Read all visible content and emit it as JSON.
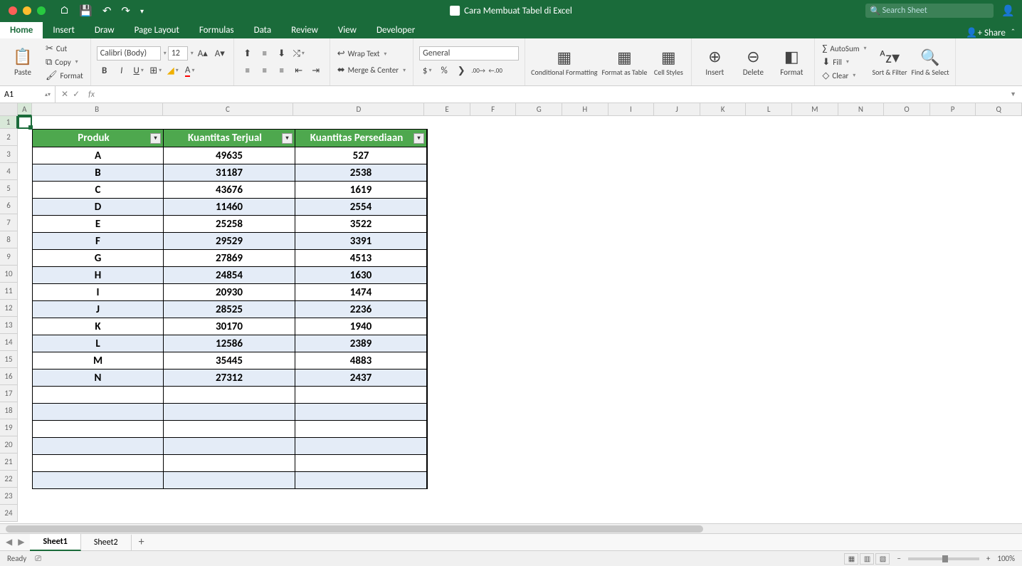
{
  "window": {
    "title": "Cara Membuat Tabel di Excel",
    "search_placeholder": "Search Sheet"
  },
  "tabs": [
    "Home",
    "Insert",
    "Draw",
    "Page Layout",
    "Formulas",
    "Data",
    "Review",
    "View",
    "Developer"
  ],
  "share_label": "Share",
  "ribbon": {
    "paste": "Paste",
    "cut": "Cut",
    "copy": "Copy",
    "format_painter": "Format",
    "font_name": "Calibri (Body)",
    "font_size": "12",
    "wrap_text": "Wrap Text",
    "merge_center": "Merge & Center",
    "number_format": "General",
    "cond_fmt": "Conditional Formatting",
    "fmt_table": "Format as Table",
    "cell_styles": "Cell Styles",
    "insert": "Insert",
    "delete": "Delete",
    "format": "Format",
    "autosum": "AutoSum",
    "fill": "Fill",
    "clear": "Clear",
    "sort_filter": "Sort & Filter",
    "find_select": "Find & Select"
  },
  "cell_ref": "A1",
  "columns": [
    "A",
    "B",
    "C",
    "D",
    "E",
    "F",
    "G",
    "H",
    "I",
    "J",
    "K",
    "L",
    "M",
    "N",
    "O",
    "P",
    "Q"
  ],
  "table": {
    "headers": [
      "Produk",
      "Kuantitas Terjual",
      "Kuantitas Persediaan"
    ],
    "rows": [
      [
        "A",
        "49635",
        "527"
      ],
      [
        "B",
        "31187",
        "2538"
      ],
      [
        "C",
        "43676",
        "1619"
      ],
      [
        "D",
        "11460",
        "2554"
      ],
      [
        "E",
        "25258",
        "3522"
      ],
      [
        "F",
        "29529",
        "3391"
      ],
      [
        "G",
        "27869",
        "4513"
      ],
      [
        "H",
        "24854",
        "1630"
      ],
      [
        "I",
        "20930",
        "1474"
      ],
      [
        "J",
        "28525",
        "2236"
      ],
      [
        "K",
        "30170",
        "1940"
      ],
      [
        "L",
        "12586",
        "2389"
      ],
      [
        "M",
        "35445",
        "4883"
      ],
      [
        "N",
        "27312",
        "2437"
      ]
    ],
    "empty_rows": 6
  },
  "sheets": [
    "Sheet1",
    "Sheet2"
  ],
  "status": {
    "ready": "Ready",
    "zoom": "100%"
  }
}
